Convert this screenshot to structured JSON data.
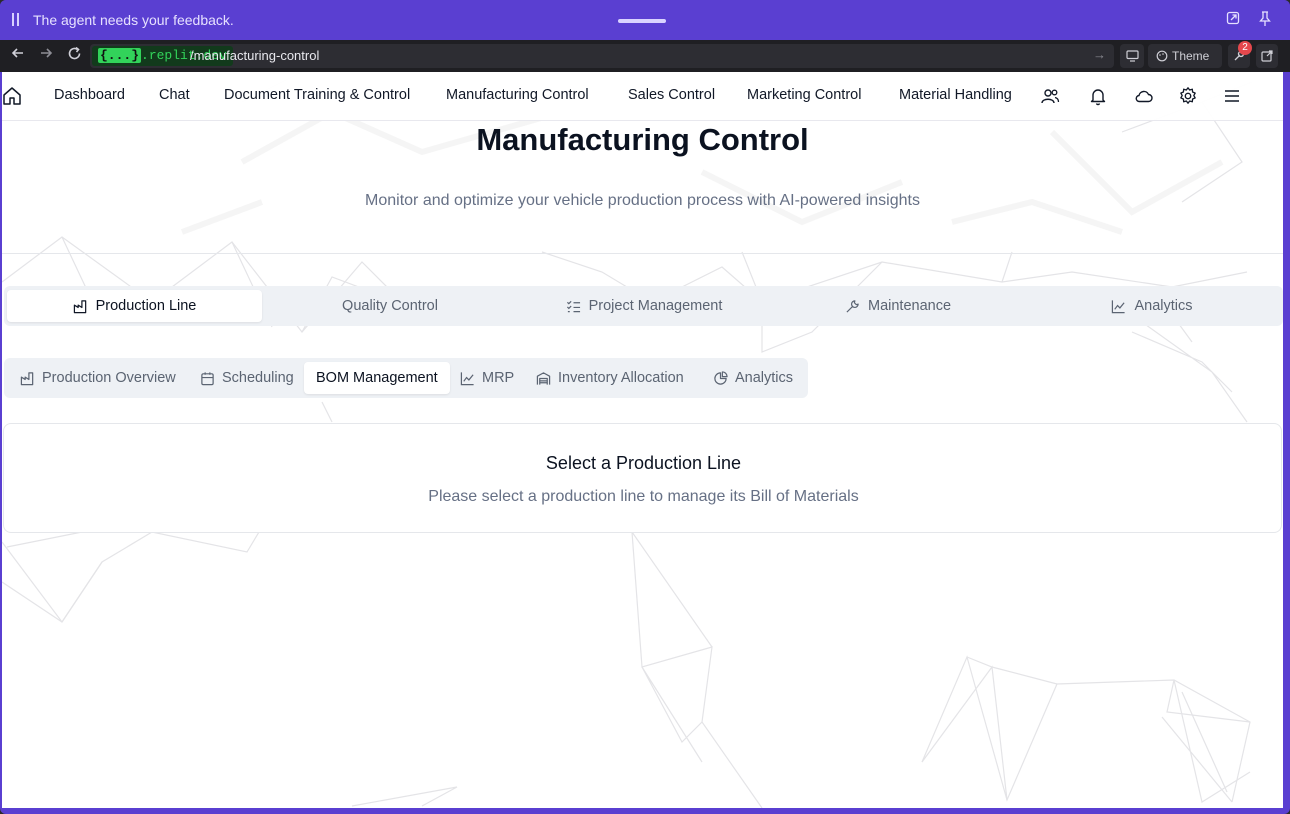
{
  "agent_bar": {
    "message": "The agent needs your feedback."
  },
  "browser": {
    "domain_prefix": "{...}",
    "domain_suffix": ".replit.dev",
    "path": "/manufacturing-control",
    "theme_label": "Theme",
    "notification_count": "2"
  },
  "nav": {
    "links": [
      "Dashboard",
      "Chat",
      "Document Training & Control",
      "Manufacturing Control",
      "Sales Control",
      "Marketing Control",
      "Material Handling"
    ]
  },
  "hero": {
    "title": "Manufacturing Control",
    "subtitle": "Monitor and optimize your vehicle production process with AI-powered insights"
  },
  "main_tabs": [
    "Production Line",
    "Quality Control",
    "Project Management",
    "Maintenance",
    "Analytics"
  ],
  "main_tabs_active": "Production Line",
  "sub_tabs": [
    "Production Overview",
    "Scheduling",
    "BOM Management",
    "MRP",
    "Inventory Allocation",
    "Analytics"
  ],
  "sub_tabs_active": "BOM Management",
  "empty_state": {
    "title": "Select a Production Line",
    "description": "Please select a production line to manage its Bill of Materials"
  },
  "colors": {
    "agent_bar": "#5a3fd1",
    "browser_chrome": "#1f1f23",
    "domain_green": "#32d35a",
    "text_muted": "#667085",
    "tab_track": "#eef1f5"
  }
}
